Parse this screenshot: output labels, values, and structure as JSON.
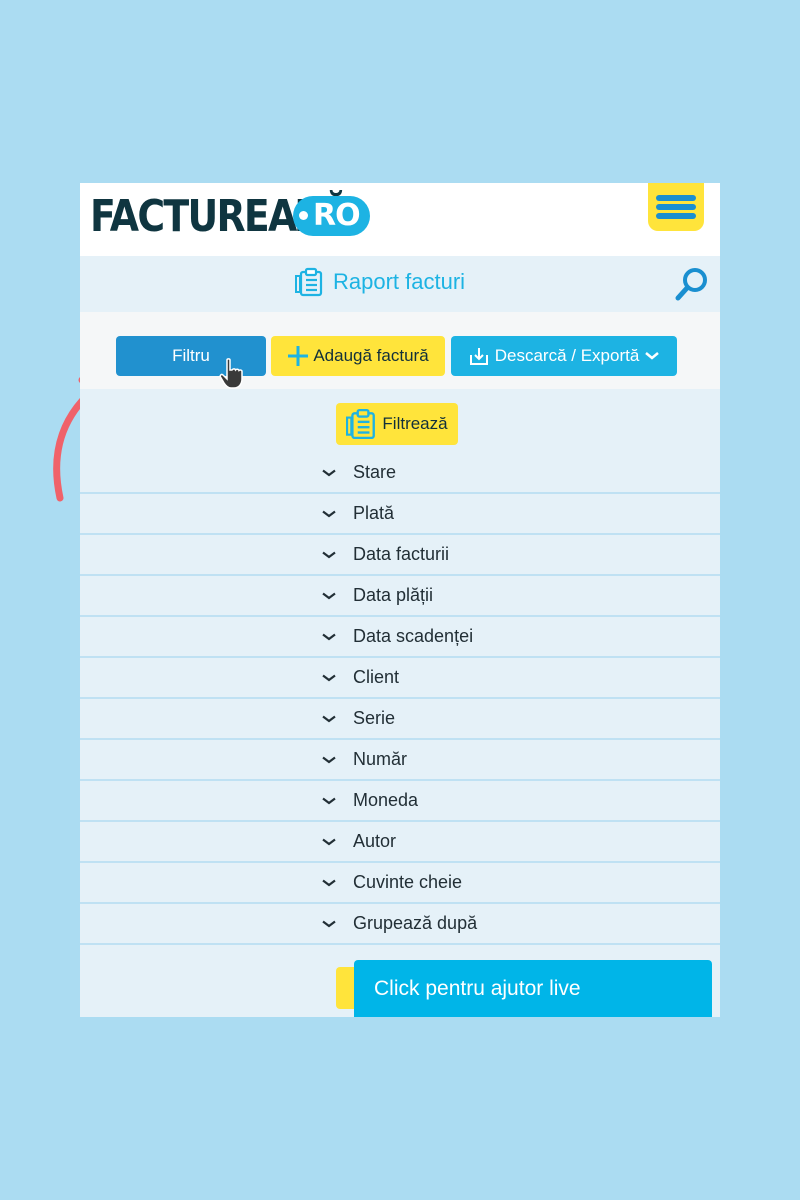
{
  "header": {
    "logo_text": "FACTUREAZĂ",
    "logo_badge": "RO",
    "menu_icon": "hamburger-menu-icon"
  },
  "report": {
    "title": "Raport facturi",
    "title_icon": "clipboard-icon",
    "search_icon": "search-icon"
  },
  "toolbar": {
    "filter_label": "Filtru",
    "add_label": "Adaugă factură",
    "add_icon": "plus-icon",
    "export_label": "Descarcă / Exportă",
    "export_icon": "download-icon"
  },
  "filter": {
    "apply_label": "Filtrează",
    "items": [
      {
        "label": "Stare"
      },
      {
        "label": "Plată"
      },
      {
        "label": "Data facturii"
      },
      {
        "label": "Data plății"
      },
      {
        "label": "Data scadenței"
      },
      {
        "label": "Client"
      },
      {
        "label": "Serie"
      },
      {
        "label": "Număr"
      },
      {
        "label": "Moneda"
      },
      {
        "label": "Autor"
      },
      {
        "label": "Cuvinte cheie"
      },
      {
        "label": "Grupează după"
      }
    ]
  },
  "live_help": {
    "label": "Click pentru ajutor live"
  },
  "colors": {
    "background": "#abdcf2",
    "brand_blue": "#1db3e3",
    "brand_yellow": "#ffe43b",
    "filter_button": "#2191cf",
    "arrow": "#f0626a"
  }
}
